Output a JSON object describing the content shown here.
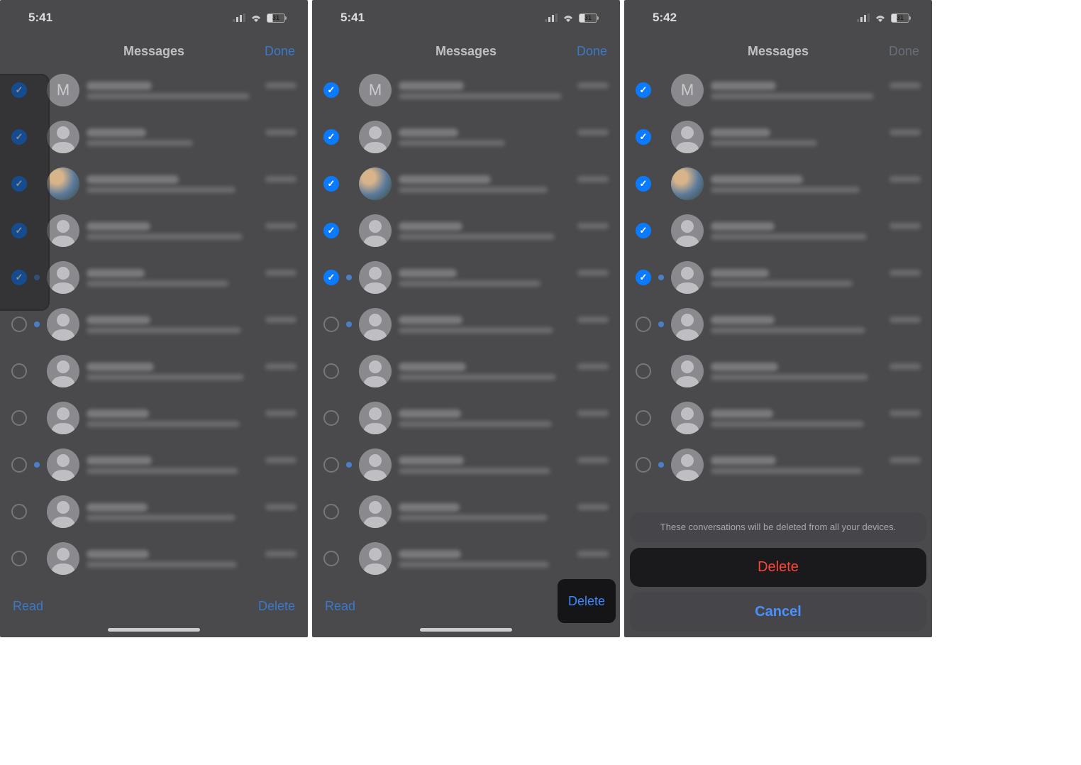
{
  "screens": [
    {
      "time": "5:41",
      "battery": "31",
      "title": "Messages",
      "done": "Done",
      "read": "Read",
      "delete": "Delete"
    },
    {
      "time": "5:41",
      "battery": "31",
      "title": "Messages",
      "done": "Done",
      "read": "Read",
      "delete": "Delete"
    },
    {
      "time": "5:42",
      "battery": "31",
      "title": "Messages",
      "done": "Done"
    }
  ],
  "rows": [
    {
      "selected": true,
      "unread": false,
      "avatar": "letter",
      "letter": "M",
      "nameW": 92,
      "prevW": 230
    },
    {
      "selected": true,
      "unread": false,
      "avatar": "silhouette",
      "nameW": 84,
      "prevW": 150
    },
    {
      "selected": true,
      "unread": false,
      "avatar": "photo",
      "nameW": 130,
      "prevW": 210
    },
    {
      "selected": true,
      "unread": false,
      "avatar": "silhouette",
      "nameW": 90,
      "prevW": 220
    },
    {
      "selected": true,
      "unread": true,
      "avatar": "silhouette",
      "nameW": 82,
      "prevW": 200
    },
    {
      "selected": false,
      "unread": true,
      "avatar": "silhouette",
      "nameW": 90,
      "prevW": 218
    },
    {
      "selected": false,
      "unread": false,
      "avatar": "silhouette",
      "nameW": 95,
      "prevW": 222
    },
    {
      "selected": false,
      "unread": false,
      "avatar": "silhouette",
      "nameW": 88,
      "prevW": 216
    },
    {
      "selected": false,
      "unread": true,
      "avatar": "silhouette",
      "nameW": 92,
      "prevW": 214
    },
    {
      "selected": false,
      "unread": false,
      "avatar": "silhouette",
      "nameW": 86,
      "prevW": 210
    },
    {
      "selected": false,
      "unread": false,
      "avatar": "silhouette",
      "nameW": 88,
      "prevW": 212
    }
  ],
  "sheet": {
    "message": "These conversations will be deleted from all your devices.",
    "delete": "Delete",
    "cancel": "Cancel"
  }
}
